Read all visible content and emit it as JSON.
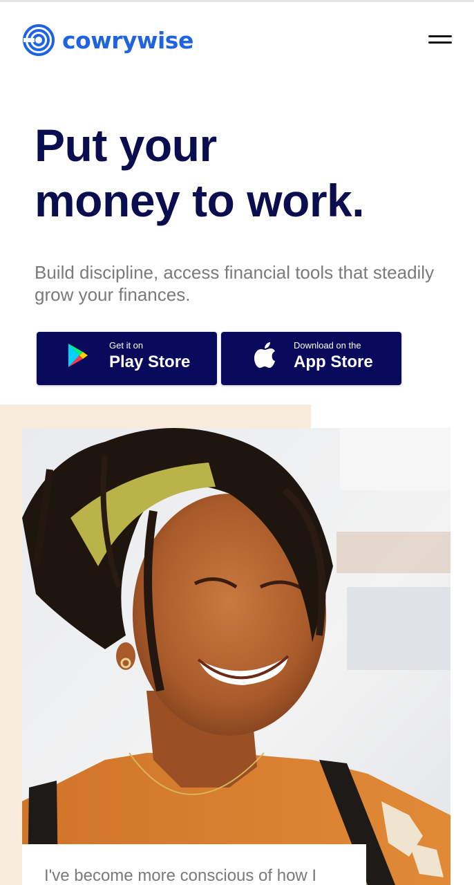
{
  "header": {
    "brand_name": "cowrywise",
    "brand_color": "#1e63e0",
    "logo_icon": "spiral-rings-icon",
    "menu_icon": "hamburger-menu-icon"
  },
  "hero": {
    "title_line1": "Put your",
    "title_line2": "money to work.",
    "subtitle": "Build discipline, access financial tools that steadily grow your finances.",
    "title_color": "#0a0d4e"
  },
  "store_buttons": {
    "play": {
      "small": "Get it on",
      "big": "Play Store",
      "icon": "google-play-icon"
    },
    "app": {
      "small": "Download on the",
      "big": "App Store",
      "icon": "apple-icon"
    },
    "button_color": "#0a0a5c"
  },
  "testimonial": {
    "quote_start": "I've become more conscious of how I",
    "accent_bg": "#f8ebd9"
  }
}
